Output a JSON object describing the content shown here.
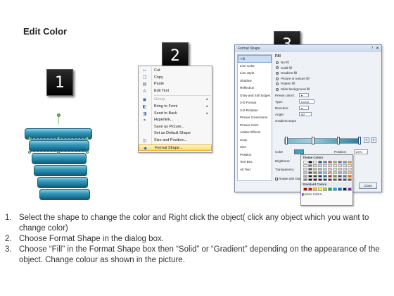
{
  "title": "Edit Color",
  "badges": [
    "1",
    "2",
    "3"
  ],
  "context_menu": {
    "items": [
      {
        "label": "Cut",
        "icon": "scissors-icon",
        "glyph": "✂",
        "type": "item"
      },
      {
        "label": "Copy",
        "icon": "copy-icon",
        "glyph": "❐",
        "type": "item"
      },
      {
        "label": "Paste",
        "icon": "paste-icon",
        "glyph": "▤",
        "type": "item"
      },
      {
        "label": "Edit Text",
        "icon": "text-icon",
        "glyph": "A",
        "type": "item"
      },
      {
        "type": "separator"
      },
      {
        "label": "Group",
        "icon": "group-icon",
        "glyph": "▣",
        "type": "item",
        "disabled": true,
        "submenu": true
      },
      {
        "label": "Bring to Front",
        "icon": "bring-front-icon",
        "glyph": "◧",
        "type": "item",
        "submenu": true
      },
      {
        "label": "Send to Back",
        "icon": "send-back-icon",
        "glyph": "◨",
        "type": "item",
        "submenu": true
      },
      {
        "label": "Hyperlink...",
        "icon": "hyperlink-icon",
        "glyph": "⚭",
        "type": "item"
      },
      {
        "label": "Save as Picture...",
        "icon": "",
        "glyph": "",
        "type": "item"
      },
      {
        "label": "Set as Default Shape",
        "icon": "",
        "glyph": "",
        "type": "item"
      },
      {
        "label": "Size and Position...",
        "icon": "size-icon",
        "glyph": "◫",
        "type": "item"
      },
      {
        "label": "Format Shape...",
        "icon": "format-shape-icon",
        "glyph": "◆",
        "type": "item",
        "highlight": true
      }
    ]
  },
  "dialog": {
    "title": "Format Shape",
    "help": "?",
    "close": "✕",
    "categories": [
      "Fill",
      "Line Color",
      "Line Style",
      "Shadow",
      "Reflection",
      "Glow and Soft Edges",
      "3-D Format",
      "3-D Rotation",
      "Picture Corrections",
      "Picture Color",
      "Artistic Effects",
      "Crop",
      "Size",
      "Position",
      "Text Box",
      "Alt Text"
    ],
    "active_category": "Fill",
    "fill_heading": "Fill",
    "fill_options": [
      {
        "label": "No fill",
        "selected": false
      },
      {
        "label": "Solid fill",
        "selected": false
      },
      {
        "label": "Gradient fill",
        "selected": true
      },
      {
        "label": "Picture or texture fill",
        "selected": false
      },
      {
        "label": "Pattern fill",
        "selected": false
      },
      {
        "label": "Slide background fill",
        "selected": false
      }
    ],
    "props": [
      {
        "label": "Preset colors:",
        "value": "▾"
      },
      {
        "label": "Type:",
        "value": "Linear"
      },
      {
        "label": "Direction:",
        "value": "▾"
      },
      {
        "label": "Angle:",
        "value": "90°"
      }
    ],
    "gradient_stops_label": "Gradient stops",
    "color_label": "Color",
    "position_label": "Position:",
    "position_value": "100%",
    "brightness_label": "Brightness",
    "transparency_label": "Transparency",
    "rotate_label": "Rotate with shape",
    "close_button": "Close"
  },
  "palette": {
    "theme_heading": "Theme Colors",
    "standard_heading": "Standard Colors",
    "more_colors": "More Colors...",
    "theme_colors": [
      "#ffffff",
      "#000000",
      "#eeece1",
      "#1f497d",
      "#4f81bd",
      "#c0504d",
      "#9bbb59",
      "#8064a2",
      "#4bacc6",
      "#f79646",
      "#f2f2f2",
      "#7f7f7f",
      "#ddd9c3",
      "#c6d9f0",
      "#dbe5f1",
      "#f2dcdb",
      "#ebf1dd",
      "#e5e0ec",
      "#dbeef3",
      "#fdeada",
      "#d8d8d8",
      "#595959",
      "#c4bd97",
      "#8db3e2",
      "#b8cce4",
      "#e5b9b7",
      "#d7e3bc",
      "#ccc1d9",
      "#b7dde8",
      "#fbd5b5",
      "#bfbfbf",
      "#3f3f3f",
      "#938953",
      "#548dd4",
      "#95b3d7",
      "#d99694",
      "#c3d69b",
      "#b2a2c7",
      "#92cddc",
      "#fac08f",
      "#a5a5a5",
      "#262626",
      "#494429",
      "#17365d",
      "#366092",
      "#953734",
      "#76923c",
      "#5f497a",
      "#31859b",
      "#e36c09",
      "#7f7f7f",
      "#0c0c0c",
      "#1d1b10",
      "#0f243e",
      "#244061",
      "#632423",
      "#4f6128",
      "#3f3151",
      "#205867",
      "#974806"
    ],
    "standard_colors": [
      "#c00000",
      "#ff0000",
      "#ffc000",
      "#ffff00",
      "#92d050",
      "#00b050",
      "#00b0f0",
      "#0070c0",
      "#002060",
      "#7030a0"
    ]
  },
  "instructions": [
    {
      "num": "1.",
      "text": "Select the shape to change the color and Right click the object( click any object which you want to change color)"
    },
    {
      "num": "2.",
      "text": "Choose Format Shape in the dialog box."
    },
    {
      "num": "3.",
      "text": "Choose “Fill” in the Format Shape box then “Solid” or “Gradient” depending on the appearance of the object. Change colour as shown in the picture."
    }
  ]
}
